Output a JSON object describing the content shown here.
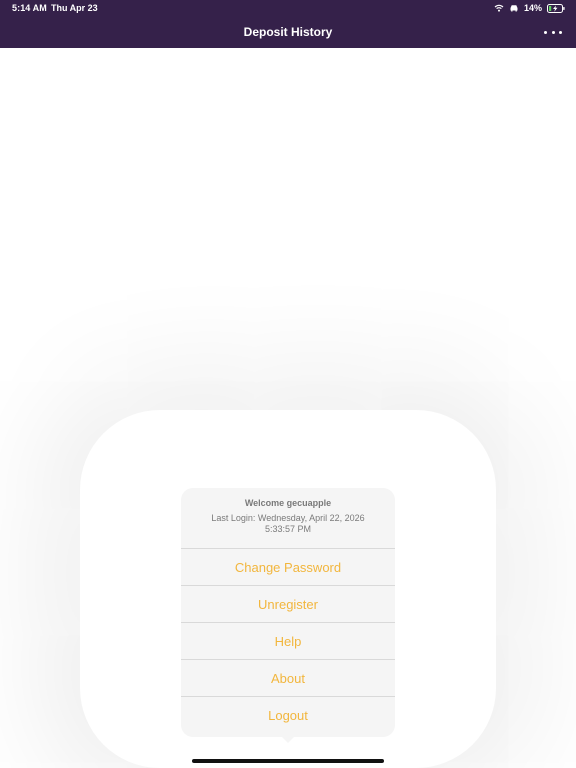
{
  "status_bar": {
    "time": "5:14 AM",
    "date": "Thu Apr 23",
    "battery": "14%",
    "icons": [
      "wifi-icon",
      "car-icon",
      "battery-charging-icon"
    ]
  },
  "nav": {
    "title": "Deposit History",
    "more_icon": "ellipsis-icon"
  },
  "popover": {
    "welcome": "Welcome gecuapple",
    "last_login": "Last Login: Wednesday, April 22, 2026 5:33:57 PM",
    "items": [
      {
        "label": "Change Password"
      },
      {
        "label": "Unregister"
      },
      {
        "label": "Help"
      },
      {
        "label": "About"
      },
      {
        "label": "Logout"
      }
    ]
  },
  "colors": {
    "nav_background": "#35214a",
    "menu_text": "#f2b63d",
    "popover_background": "#f5f5f5"
  }
}
